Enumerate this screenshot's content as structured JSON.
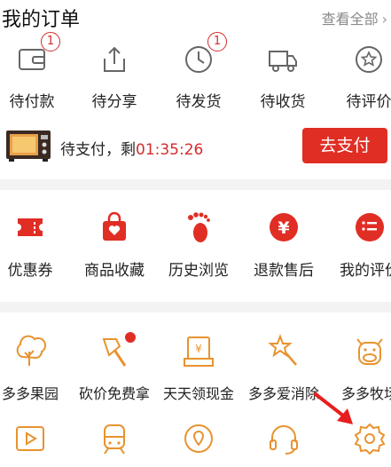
{
  "header": {
    "title": "我的订单",
    "view_all": "查看全部",
    "view_all_icon": "chevron-right-icon"
  },
  "orders": [
    {
      "label": "待付款",
      "icon": "wallet-icon",
      "badge": "1"
    },
    {
      "label": "待分享",
      "icon": "share-icon",
      "badge": ""
    },
    {
      "label": "待发货",
      "icon": "clock-icon",
      "badge": "1"
    },
    {
      "label": "待收货",
      "icon": "truck-icon",
      "badge": ""
    },
    {
      "label": "待评价",
      "icon": "review-icon",
      "badge": ""
    }
  ],
  "pending_payment": {
    "text": "待支付，剩",
    "time": "01:35:26",
    "button": "去支付"
  },
  "services": [
    {
      "label": "优惠券",
      "icon": "coupon-icon"
    },
    {
      "label": "商品收藏",
      "icon": "favorite-bag-icon"
    },
    {
      "label": "历史浏览",
      "icon": "footprint-icon"
    },
    {
      "label": "退款售后",
      "icon": "refund-yen-icon"
    },
    {
      "label": "我的评价",
      "icon": "my-reviews-icon"
    }
  ],
  "games": [
    {
      "label": "多多果园",
      "icon": "tree-icon"
    },
    {
      "label": "砍价免费拿",
      "icon": "axe-icon",
      "dot": true
    },
    {
      "label": "天天领现金",
      "icon": "cash-yen-icon"
    },
    {
      "label": "多多爱消除",
      "icon": "star-wand-icon"
    },
    {
      "label": "多多牧场",
      "icon": "cow-icon"
    }
  ],
  "bottom_icons": [
    {
      "icon": "video-play-icon"
    },
    {
      "icon": "train-icon"
    },
    {
      "icon": "location-pin-icon"
    },
    {
      "icon": "headset-icon"
    },
    {
      "icon": "settings-gear-icon"
    }
  ],
  "colors": {
    "accent": "#e02e24",
    "icon_gray": "#666666",
    "icon_orange": "#e8932f",
    "divider": "#f3f3f3"
  }
}
